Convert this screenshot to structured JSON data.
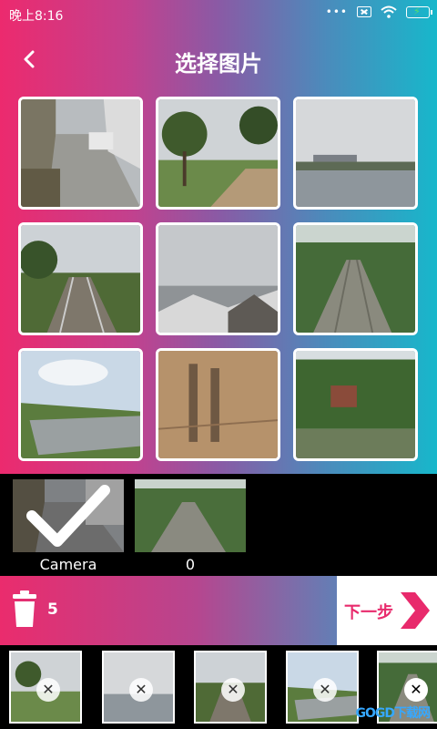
{
  "status_bar": {
    "time": "晚上8:16",
    "icons": [
      "more-dots-icon",
      "no-sim-icon",
      "wifi-icon",
      "battery-charging-icon"
    ]
  },
  "header": {
    "title": "选择图片",
    "back_icon": "chevron-left-icon"
  },
  "grid": {
    "photos": [
      {
        "subject": "alley-with-car"
      },
      {
        "subject": "park-trees"
      },
      {
        "subject": "lake-overcast"
      },
      {
        "subject": "railway-trees"
      },
      {
        "subject": "town-snow-roofs"
      },
      {
        "subject": "railway-steps"
      },
      {
        "subject": "canal-hills"
      },
      {
        "subject": "shadow-pavement"
      },
      {
        "subject": "pond-forest"
      }
    ]
  },
  "albums": [
    {
      "label": "Camera",
      "selected": true
    },
    {
      "label": "0",
      "selected": false
    }
  ],
  "action_bar": {
    "trash_icon": "trash-icon",
    "count": "5",
    "next_label": "下一步",
    "next_icon": "arrow-right-icon"
  },
  "selected_thumbs": [
    {
      "subject": "park-trees",
      "remove_icon": "close-icon"
    },
    {
      "subject": "lake-overcast",
      "remove_icon": "close-icon"
    },
    {
      "subject": "railway-trees",
      "remove_icon": "close-icon"
    },
    {
      "subject": "canal-hills",
      "remove_icon": "close-icon"
    },
    {
      "subject": "railway-steps",
      "remove_icon": "close-icon"
    }
  ],
  "watermark": "GOGD下载网",
  "colors": {
    "accent_pink": "#e82a6c",
    "accent_cyan": "#17b7cb"
  }
}
